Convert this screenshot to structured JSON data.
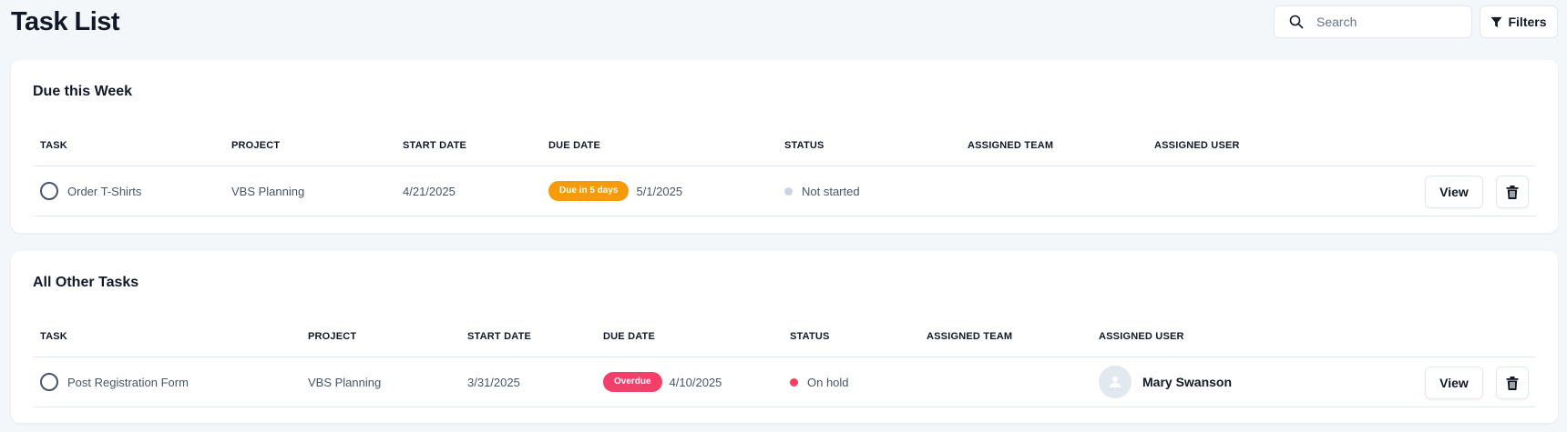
{
  "page": {
    "title": "Task List",
    "search_placeholder": "Search",
    "filters_label": "Filters",
    "icons": {
      "search": "search-icon",
      "filter": "filter-icon",
      "delete": "trash-icon",
      "avatar": "user-icon"
    }
  },
  "colors": {
    "due_soon": "#f59a0b",
    "overdue": "#f43f6b",
    "not_started": "#cbd5e1",
    "on_hold": "#f43f5e"
  },
  "sections": [
    {
      "title": "Due this Week",
      "columns": [
        "Task",
        "Project",
        "Start Date",
        "Due Date",
        "Status",
        "Assigned Team",
        "Assigned User"
      ],
      "rows": [
        {
          "task": "Order T-Shirts",
          "project": "VBS Planning",
          "start_date": "4/21/2025",
          "due_badge": "Due in 5 days",
          "due_date": "5/1/2025",
          "status": "Not started",
          "assigned_team": "",
          "assigned_user": "",
          "view_label": "View"
        }
      ]
    },
    {
      "title": "All Other Tasks",
      "columns": [
        "Task",
        "Project",
        "Start Date",
        "Due Date",
        "Status",
        "Assigned Team",
        "Assigned User"
      ],
      "rows": [
        {
          "task": "Post Registration Form",
          "project": "VBS Planning",
          "start_date": "3/31/2025",
          "due_badge": "Overdue",
          "due_date": "4/10/2025",
          "status": "On hold",
          "assigned_team": "",
          "assigned_user": "Mary Swanson",
          "view_label": "View"
        }
      ]
    }
  ]
}
